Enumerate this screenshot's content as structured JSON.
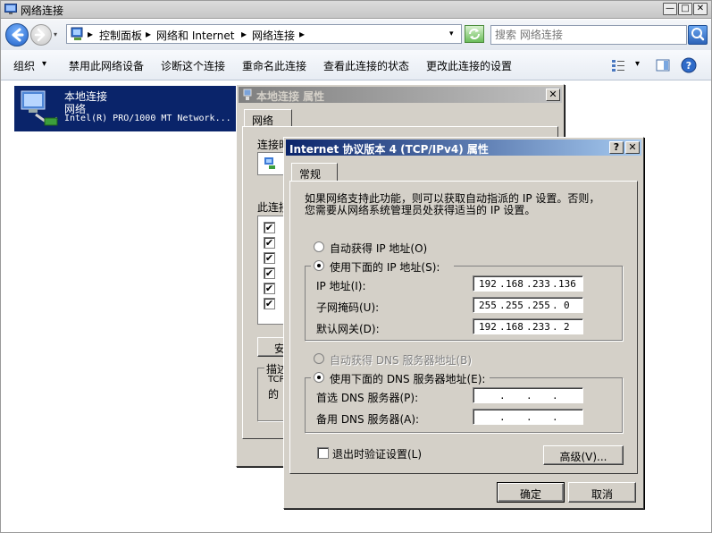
{
  "explorer": {
    "title": "网络连接",
    "breadcrumbs": [
      "控制面板",
      "网络和 Internet",
      "网络连接"
    ],
    "search_placeholder": "搜索 网络连接",
    "commands": [
      "组织",
      "禁用此网络设备",
      "诊断这个连接",
      "重命名此连接",
      "查看此连接的状态",
      "更改此连接的设置"
    ],
    "connection": {
      "name": "本地连接",
      "network": "网络",
      "device": "Intel(R) PRO/1000 MT Network..."
    }
  },
  "props_dialog": {
    "title": "本地连接 属性",
    "tab": "网络",
    "connect_label_partial": "连接时",
    "items_label_partial": "此连接",
    "install_partial": "安",
    "desc_label_partial": "描述",
    "desc_text_line1": "TCP",
    "desc_text_line2": "的"
  },
  "ipv4_dialog": {
    "title": "Internet 协议版本 4 (TCP/IPv4) 属性",
    "tab": "常规",
    "description_line1": "如果网络支持此功能，则可以获取自动指派的 IP 设置。否则，",
    "description_line2": "您需要从网络系统管理员处获得适当的 IP 设置。",
    "auto_ip_label": "自动获得 IP 地址(O)",
    "manual_ip_label": "使用下面的 IP 地址(S):",
    "ip_label": "IP 地址(I):",
    "mask_label": "子网掩码(U):",
    "gateway_label": "默认网关(D):",
    "ip": [
      "192",
      "168",
      "233",
      "136"
    ],
    "mask": [
      "255",
      "255",
      "255",
      "0"
    ],
    "gateway": [
      "192",
      "168",
      "233",
      "2"
    ],
    "auto_dns_label": "自动获得 DNS 服务器地址(B)",
    "manual_dns_label": "使用下面的 DNS 服务器地址(E):",
    "pref_dns_label": "首选 DNS 服务器(P):",
    "alt_dns_label": "备用 DNS 服务器(A):",
    "validate_label": "退出时验证设置(L)",
    "advanced_label": "高级(V)...",
    "ok_label": "确定",
    "cancel_label": "取消",
    "dot": "."
  },
  "icons": {
    "window_close": "✕",
    "window_max": "□",
    "window_min": "—",
    "help": "?",
    "check": "✔",
    "dropdown": "▾",
    "crumb_sep": "▸"
  },
  "colors": {
    "selection": "#0a246a",
    "active_title": "#0a246a",
    "dialog_face": "#d4d0c8"
  }
}
